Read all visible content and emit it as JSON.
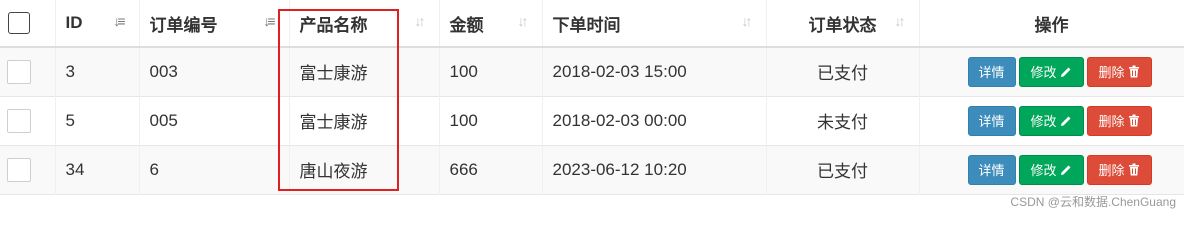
{
  "table": {
    "headers": {
      "id": "ID",
      "order_no": "订单编号",
      "product_name": "产品名称",
      "amount": "金额",
      "order_time": "下单时间",
      "order_status": "订单状态",
      "actions": "操作"
    },
    "rows": [
      {
        "id": "3",
        "order_no": "003",
        "product_name": "富士康游",
        "amount": "100",
        "order_time": "2018-02-03 15:00",
        "order_status": "已支付"
      },
      {
        "id": "5",
        "order_no": "005",
        "product_name": "富士康游",
        "amount": "100",
        "order_time": "2018-02-03 00:00",
        "order_status": "未支付"
      },
      {
        "id": "34",
        "order_no": "6",
        "product_name": "唐山夜游",
        "amount": "666",
        "order_time": "2023-06-12 10:20",
        "order_status": "已支付"
      }
    ],
    "buttons": {
      "detail": "详情",
      "edit": "修改",
      "delete": "删除"
    }
  },
  "icons": {
    "sort_asc_active": "sort-amount-asc-icon",
    "sort": "sort-icon",
    "edit": "pencil-icon",
    "delete": "trash-icon"
  },
  "colors": {
    "info": "#3c8dbc",
    "success": "#00a65a",
    "danger": "#dd4b39",
    "highlight": "#e02020"
  },
  "watermark": "CSDN @云和数据.ChenGuang"
}
